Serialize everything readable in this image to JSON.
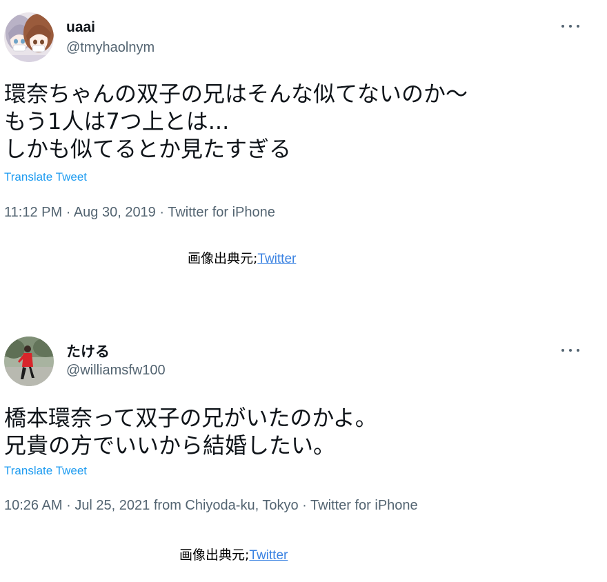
{
  "tweets": [
    {
      "display_name": "uaai",
      "handle": "@tmyhaolnym",
      "avatar_icon": "anime-twin-girls-avatar",
      "text_lines": [
        "環奈ちゃんの双子の兄はそんな似てないのか〜",
        "もう1人は7つ上とは...",
        "しかも似てるとか見たすぎる"
      ],
      "translate_label": "Translate Tweet",
      "time": "11:12 PM",
      "date": "Aug 30, 2019",
      "location": "",
      "client": "Twitter for iPhone",
      "source_prefix": "画像出典元;",
      "source_link": "Twitter"
    },
    {
      "display_name": "たける",
      "handle": "@williamsfw100",
      "avatar_icon": "running-person-photo-avatar",
      "text_lines": [
        "橋本環奈って双子の兄がいたのかよ。",
        "兄貴の方でいいから結婚したい。"
      ],
      "translate_label": "Translate Tweet",
      "time": "10:26 AM",
      "date": "Jul 25, 2021",
      "location_prefix": "from",
      "location": "Chiyoda-ku, Tokyo",
      "client": "Twitter for iPhone",
      "source_prefix": "画像出典元;",
      "source_link": "Twitter"
    }
  ],
  "separator": "·",
  "more_icon": "more-horizontal-icon",
  "colors": {
    "text_primary": "#0f1419",
    "text_secondary": "#536471",
    "link_blue": "#1d9bf0",
    "source_link_blue": "#3b83e2"
  }
}
